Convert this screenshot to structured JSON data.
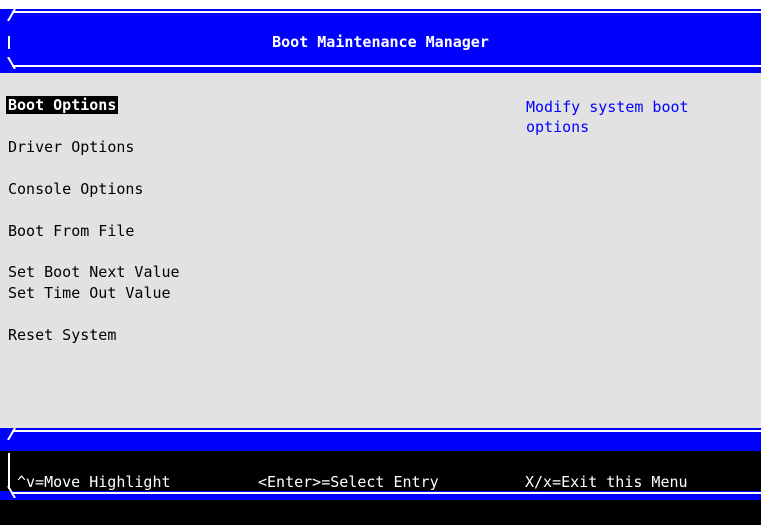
{
  "header": {
    "title": "Boot Maintenance Manager"
  },
  "menu": {
    "items": [
      {
        "label": "Boot Options"
      },
      {
        "label": "Driver Options"
      },
      {
        "label": "Console Options"
      },
      {
        "label": "Boot From File"
      },
      {
        "label": "Set Boot Next Value"
      },
      {
        "label": "Set Time Out Value"
      },
      {
        "label": "Reset System"
      }
    ],
    "selected": "Boot Options"
  },
  "help": {
    "text": "Modify system boot options"
  },
  "footer": {
    "move_hint": "^v=Move Highlight",
    "select_hint": "<Enter>=Select Entry",
    "exit_hint": "X/x=Exit this Menu"
  },
  "colors": {
    "background": "#e3e2e3",
    "accent": "#0000ff",
    "highlight": "#000000"
  }
}
